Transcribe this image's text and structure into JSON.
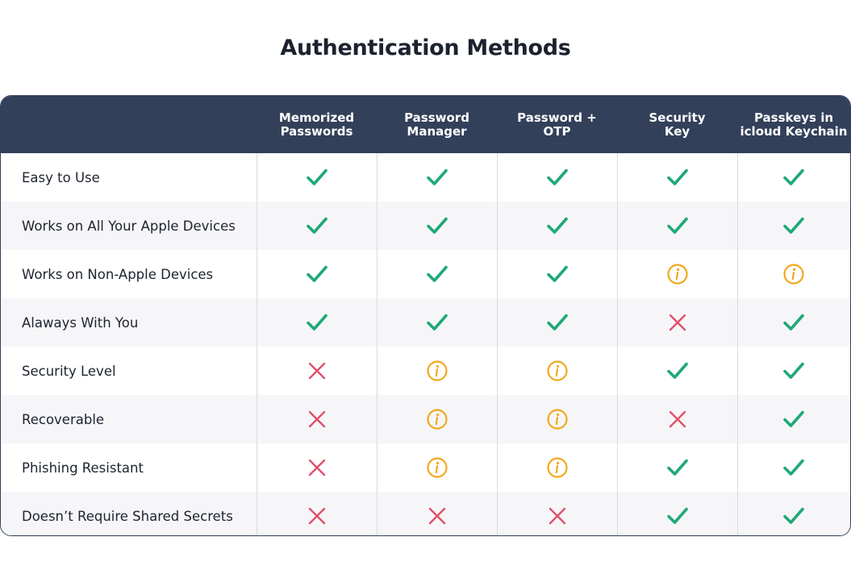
{
  "title": "Authentication Methods",
  "colors": {
    "header_bg": "#33405a",
    "check": "#1fa87a",
    "cross": "#e0506a",
    "info": "#f1a91c"
  },
  "columns": [
    "Memorized\nPasswords",
    "Password\nManager",
    "Password +\nOTP",
    "Security\nKey",
    "Passkeys in\nicloud Keychain"
  ],
  "rows": [
    {
      "label": "Easy to Use",
      "values": [
        "check",
        "check",
        "check",
        "check",
        "check"
      ]
    },
    {
      "label": "Works on All Your Apple Devices",
      "values": [
        "check",
        "check",
        "check",
        "check",
        "check"
      ]
    },
    {
      "label": "Works on Non-Apple Devices",
      "values": [
        "check",
        "check",
        "check",
        "info",
        "info"
      ]
    },
    {
      "label": "Alaways With You",
      "values": [
        "check",
        "check",
        "check",
        "cross",
        "check"
      ]
    },
    {
      "label": "Security Level",
      "values": [
        "cross",
        "info",
        "info",
        "check",
        "check"
      ]
    },
    {
      "label": "Recoverable",
      "values": [
        "cross",
        "info",
        "info",
        "cross",
        "check"
      ]
    },
    {
      "label": "Phishing Resistant",
      "values": [
        "cross",
        "info",
        "info",
        "check",
        "check"
      ]
    },
    {
      "label": "Doesn’t Require Shared Secrets",
      "values": [
        "cross",
        "cross",
        "cross",
        "check",
        "check"
      ]
    }
  ]
}
